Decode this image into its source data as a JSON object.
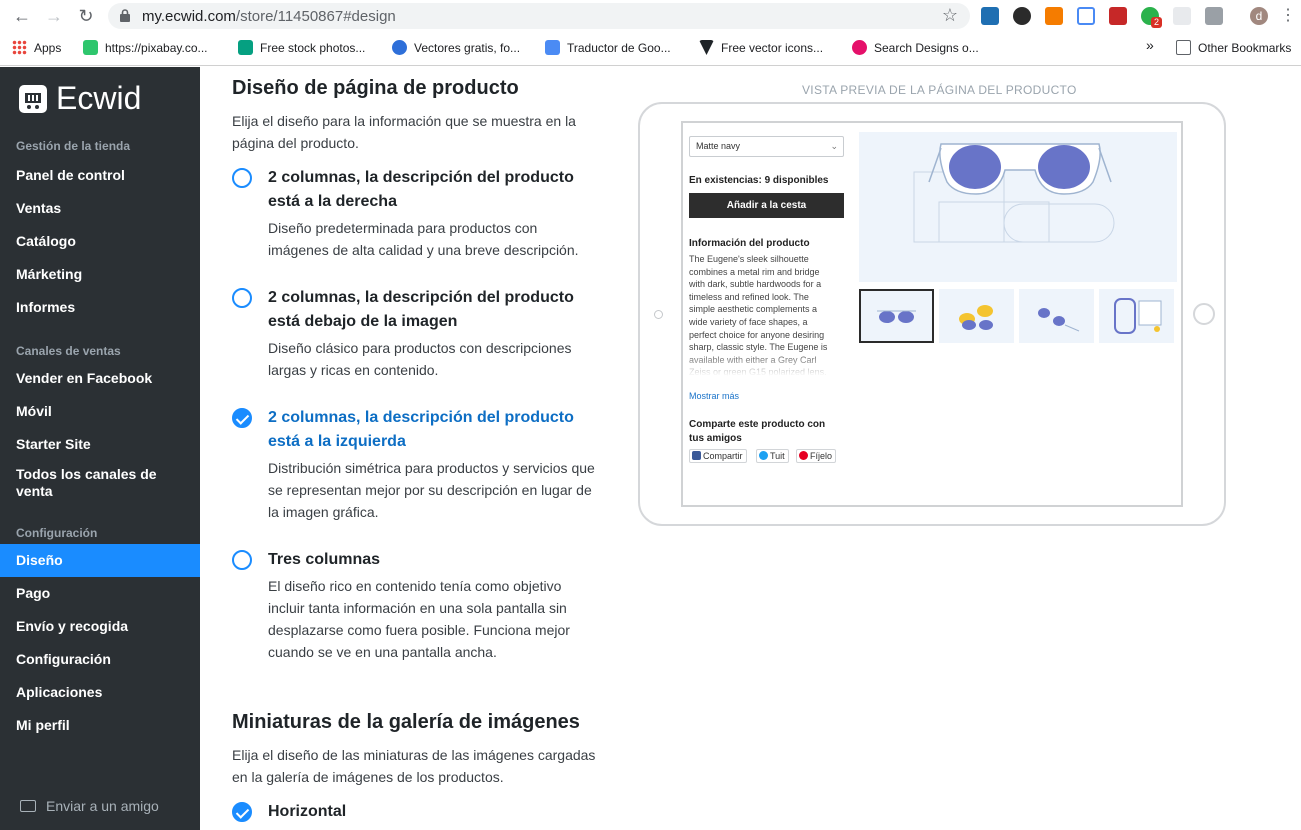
{
  "browser": {
    "url_host": "my.ecwid.com",
    "url_path": "/store/11450867#design",
    "bookmarks": [
      {
        "label": "Apps",
        "color": "#e8453c"
      },
      {
        "label": "https://pixabay.co...",
        "color": "#2ec66d"
      },
      {
        "label": "Free stock photos...",
        "color": "#05a081"
      },
      {
        "label": "Vectores gratis, fo...",
        "color": "#2e6fd9"
      },
      {
        "label": "Traductor de Goo...",
        "color": "#4b8bf4"
      },
      {
        "label": "Free vector icons...",
        "color": "#1f2428"
      },
      {
        "label": "Search Designs o...",
        "color": "#e5106a"
      }
    ],
    "overflow": "»",
    "other_bookmarks": "Other Bookmarks",
    "profile_initial": "d",
    "badge_count": "2"
  },
  "sidebar": {
    "brand": "Ecwid",
    "sections": [
      {
        "title": "Gestión de la tienda",
        "items": [
          "Panel de control",
          "Ventas",
          "Catálogo",
          "Márketing",
          "Informes"
        ]
      },
      {
        "title": "Canales de ventas",
        "items": [
          "Vender en Facebook",
          "Móvil",
          "Starter Site",
          "Todos los canales de venta"
        ]
      },
      {
        "title": "Configuración",
        "items": [
          "Diseño",
          "Pago",
          "Envío y recogida",
          "Configuración",
          "Aplicaciones",
          "Mi perfil"
        ]
      }
    ],
    "active_item": "Diseño",
    "invite": "Enviar a un amigo"
  },
  "main": {
    "section1_title": "Diseño de página de producto",
    "section1_desc": "Elija el diseño para la información que se muestra en la página del producto.",
    "options": [
      {
        "title": "2 columnas, la descripción del producto está a la derecha",
        "desc": "Diseño predeterminada para productos con imágenes de alta calidad y una breve descripción.",
        "checked": false
      },
      {
        "title": "2 columnas, la descripción del producto está debajo de la imagen",
        "desc": "Diseño clásico para productos con descripciones largas y ricas en contenido.",
        "checked": false
      },
      {
        "title": "2 columnas, la descripción del producto está a la izquierda",
        "desc": "Distribución simétrica para productos y servicios que se representan mejor por su descripción en lugar de la imagen gráfica.",
        "checked": true
      },
      {
        "title": "Tres columnas",
        "desc": "El diseño rico en contenido tenía como objetivo incluir tanta información en una sola pantalla sin desplazarse como fuera posible. Funciona mejor cuando se ve en una pantalla ancha.",
        "checked": false
      }
    ],
    "section2_title": "Miniaturas de la galería de imágenes",
    "section2_desc": "Elija el diseño de las miniaturas de las imágenes cargadas en la galería de imágenes de los productos.",
    "gallery_option": {
      "title": "Horizontal",
      "checked": true
    }
  },
  "preview": {
    "label": "VISTA PREVIA DE LA PÁGINA DEL PRODUCTO",
    "variant": "Matte navy",
    "stock": "En existencias: 9 disponibles",
    "add_to_cart": "Añadir a la cesta",
    "info_title": "Información del producto",
    "info_text": "The Eugene's sleek silhouette combines a metal rim and bridge with dark, subtle hardwoods for a timeless and refined look. The simple aesthetic complements a wide variety of face shapes, a perfect choice for anyone desiring sharp, classic style. The Eugene is available with either a Grey Carl Zeiss or green G15 polarized lens.",
    "more": "Mostrar más",
    "share_title": "Comparte este producto con tus amigos",
    "share_buttons": [
      "Compartir",
      "Tuit",
      "Fíjelo"
    ]
  }
}
